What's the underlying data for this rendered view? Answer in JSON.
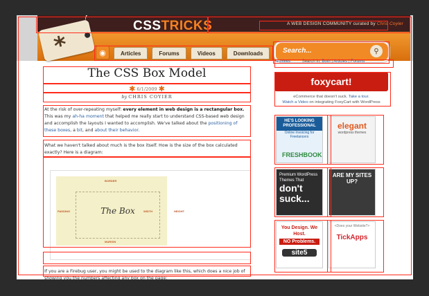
{
  "header": {
    "logo_css": "CSS",
    "logo_tricks": "TRICKS",
    "tagline_prefix": "A WEB DESIGN COMMUNITY",
    "tagline_curated": "curated by",
    "tagline_curator": "Chris Coyier",
    "tag_icon": "asterisk-tag-icon"
  },
  "nav": {
    "rss_icon": "rss-icon",
    "items": [
      "Articles",
      "Forums",
      "Videos",
      "Downloads"
    ]
  },
  "search": {
    "placeholder": "Search...",
    "icon": "magnifier-icon",
    "archives": "Archives",
    "search_in": "Search in:",
    "both": "Both",
    "articles": "Articles",
    "forums": "Forums"
  },
  "article": {
    "title": "The CSS Box Model",
    "date": "6/1/2009",
    "by": "by",
    "author": "CHRIS COYIER",
    "p1_a": "At the risk of over-repeating myself:",
    "p1_b": "every element in web design is a rectangular box.",
    "p1_c": "This was my",
    "p1_link1": "ah-ha moment",
    "p1_d": "that helped me really start to understand CSS-based web design and accomplish the layouts I wanted to accomplish. We've talked about the",
    "p1_link2": "positioning of these boxes",
    "p1_e": ", a",
    "p1_link3": "bit",
    "p1_f": ", and",
    "p1_link4": "about their behavior",
    "p1_g": ".",
    "p2": "What we haven't talked about much is the box itself. How is the size of the box calculated exactly? Here is a diagram:",
    "p3": "If you are a Firebug user, you might be used to the diagram like this, which does a nice job of showing you the numbers affecting any box on the page:"
  },
  "diagram": {
    "box_label": "The Box",
    "margin": "MARGIN",
    "padding": "PADDING",
    "width": "WIDTH",
    "height": "HEIGHT",
    "border": "BORDER"
  },
  "sidebar": {
    "foxy": "foxycart!",
    "foxy_line1": "eCommerce that doesn't suck.",
    "foxy_tour": "Take a tour.",
    "foxy_video": "Watch a Video",
    "foxy_line2": "on integrating FoxyCart with WordPress",
    "ad1_head": "HE'S LOOKING PROFESSIONAL",
    "ad1_sub": "Online Invoicing for Freelancers",
    "ad1_brand": "FRESHBOOKS",
    "ad2_brand": "elegant",
    "ad2_sub": "wordpress themes",
    "ad3_a": "Premium WordPress Themes That",
    "ad3_b": "don't suck...",
    "ad4": "ARE MY SITES UP?",
    "ad5_a": "You Design. We Host.",
    "ad5_b": "NO Problems.",
    "ad5_brand": "site5",
    "ad6_q": "<Does your Website?>",
    "ad6_brand": "TickApps"
  }
}
